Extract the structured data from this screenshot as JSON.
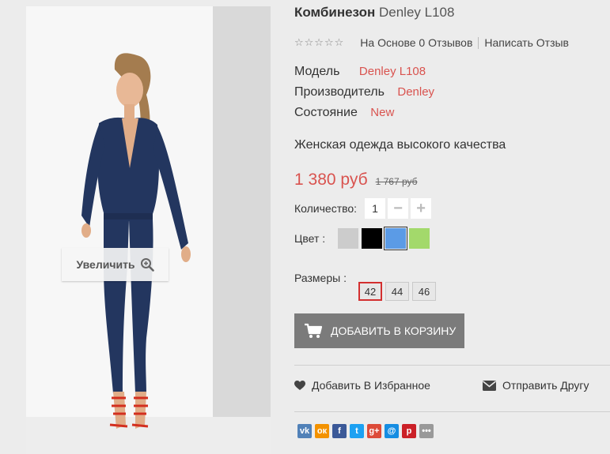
{
  "image": {
    "zoom_label": "Увеличить",
    "zoom_icon": "zoom-in-icon"
  },
  "product": {
    "title_name": "Комбинезон",
    "title_model": "Denley L108",
    "rating": {
      "stars": 0,
      "max_stars": 5,
      "reviews_label": "На Основе 0 Отзывов",
      "write_review_label": "Написать Отзыв"
    },
    "specs": {
      "model_label": "Модель",
      "model_value": "Denley L108",
      "brand_label": "Производитель",
      "brand_value": "Denley",
      "state_label": "Состояние",
      "state_value": "New"
    },
    "description": "Женская одежда высокого качества",
    "price": "1 380 руб",
    "old_price": "1 767 руб",
    "quantity": {
      "label": "Количество:",
      "value": "1",
      "minus": "−",
      "plus": "+"
    },
    "colors": {
      "label": "Цвет :",
      "options": [
        "#cccccc",
        "#000000",
        "#5b9be6",
        "#a3d96b"
      ],
      "selected_index": 2
    },
    "sizes": {
      "label": "Размеры :",
      "options": [
        "42",
        "44",
        "46"
      ],
      "selected": "42"
    },
    "add_to_cart": "Добавить в корзину",
    "wishlist": "Добавить В Избранное",
    "send_friend": "Отправить Другу"
  },
  "share": [
    {
      "name": "vk",
      "glyph": "vk",
      "color": "#5181b8"
    },
    {
      "name": "odnoklassniki",
      "glyph": "ок",
      "color": "#f39200"
    },
    {
      "name": "facebook",
      "glyph": "f",
      "color": "#3b5998"
    },
    {
      "name": "twitter",
      "glyph": "t",
      "color": "#1da1f2"
    },
    {
      "name": "google-plus",
      "glyph": "g+",
      "color": "#dd4b39"
    },
    {
      "name": "mail",
      "glyph": "@",
      "color": "#168de2"
    },
    {
      "name": "pinterest",
      "glyph": "p",
      "color": "#cb2027"
    },
    {
      "name": "more",
      "glyph": "•••",
      "color": "#999999"
    }
  ]
}
